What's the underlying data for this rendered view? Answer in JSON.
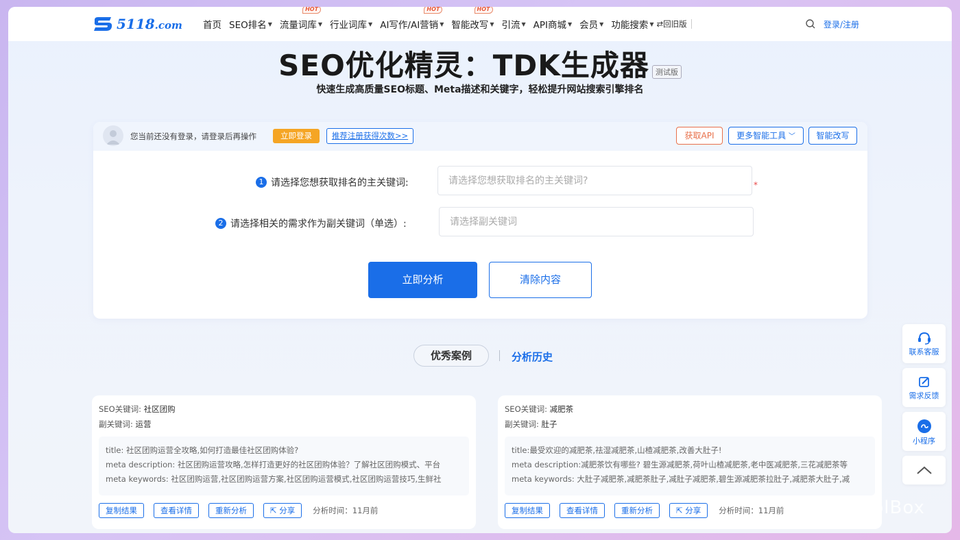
{
  "nav": {
    "logo_text": "5118",
    "logo_suffix": ".com",
    "items": [
      {
        "label": "首页",
        "dropdown": false,
        "hot": false
      },
      {
        "label": "SEO排名",
        "dropdown": true,
        "hot": false
      },
      {
        "label": "流量词库",
        "dropdown": true,
        "hot": true
      },
      {
        "label": "行业词库",
        "dropdown": true,
        "hot": false
      },
      {
        "label": "AI写作/AI营销",
        "dropdown": true,
        "hot": true
      },
      {
        "label": "智能改写",
        "dropdown": true,
        "hot": true
      },
      {
        "label": "引流",
        "dropdown": true,
        "hot": false
      },
      {
        "label": "API商城",
        "dropdown": true,
        "hot": false
      },
      {
        "label": "会员",
        "dropdown": true,
        "hot": false
      },
      {
        "label": "功能搜索",
        "dropdown": true,
        "hot": false
      }
    ],
    "hot_label": "HOT",
    "old_version": "⇄回旧版",
    "login": "登录/注册"
  },
  "hero": {
    "title": "SEO优化精灵：TDK生成器",
    "beta": "测试版",
    "subtitle": "快速生成高质量SEO标题、Meta描述和关键字，轻松提升网站搜索引擎排名"
  },
  "card": {
    "login_hint": "您当前还没有登录，请登录后再操作",
    "login_now": "立即登录",
    "register_link": "推荐注册获得次数>>",
    "get_api": "获取API",
    "more_tools": "更多智能工具",
    "smart_rewrite": "智能改写",
    "field1": {
      "num": "1",
      "label": "请选择您想获取排名的主关键词:",
      "placeholder": "请选择您想获取排名的主关键词?",
      "required": "*"
    },
    "field2": {
      "num": "2",
      "label": "请选择相关的需求作为副关键词（单选）:",
      "placeholder": "请选择副关键词"
    },
    "analyze": "立即分析",
    "clear": "清除内容"
  },
  "tabs": {
    "cases": "优秀案例",
    "history": "分析历史"
  },
  "examples": [
    {
      "seo_kw_label": "SEO关键词:",
      "seo_kw": "社区团购",
      "sub_kw_label": "副关键词:",
      "sub_kw": "运营",
      "title": "title: 社区团购运营全攻略,如何打造最佳社区团购体验?",
      "desc": "meta description: 社区团购运营攻略,怎样打造更好的社区团购体验？了解社区团购模式、平台",
      "keywords": "meta keywords: 社区团购运营,社区团购运营方案,社区团购运营模式,社区团购运营技巧,生鲜社",
      "time": "分析时间：11月前"
    },
    {
      "seo_kw_label": "SEO关键词:",
      "seo_kw": "减肥茶",
      "sub_kw_label": "副关键词:",
      "sub_kw": "肚子",
      "title": "title:最受欢迎的减肥茶,祛湿减肥茶,山楂减肥茶,改善大肚子!",
      "desc": "meta description:减肥茶饮有哪些? 碧生源减肥茶,荷叶山楂减肥茶,老中医减肥茶,三花减肥茶等",
      "keywords": "meta keywords: 大肚子减肥茶,减肥茶肚子,减肚子减肥茶,碧生源减肥茶拉肚子,减肥茶大肚子,减",
      "time": "分析时间：11月前"
    }
  ],
  "example_actions": {
    "copy": "复制结果",
    "detail": "查看详情",
    "reanalyze": "重新分析",
    "share": "分享"
  },
  "side": {
    "service": "联系客服",
    "feedback": "需求反馈",
    "miniapp": "小程序"
  },
  "watermark": "AiToolBox",
  "colors": {
    "brand": "#1a6ee8",
    "orange": "#f5a524",
    "api": "#e8704a",
    "required": "#e84a4a"
  }
}
